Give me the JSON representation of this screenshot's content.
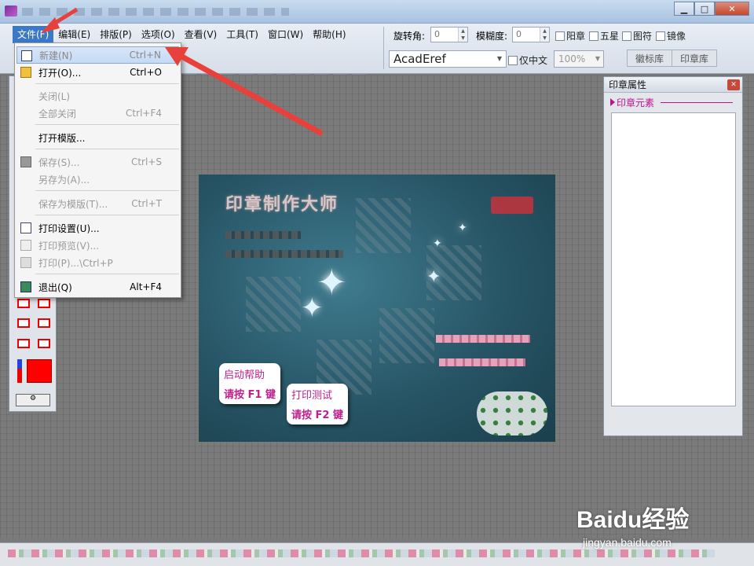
{
  "menubar": {
    "items": [
      "文件(F)",
      "编辑(E)",
      "排版(P)",
      "选项(O)",
      "查看(V)",
      "工具(T)",
      "窗口(W)",
      "帮助(H)"
    ]
  },
  "toolbar": {
    "rotate_label": "旋转角:",
    "rotate_value": "0",
    "blur_label": "模糊度:",
    "blur_value": "0",
    "checkboxes": [
      "阳章",
      "五星",
      "图符",
      "镜像"
    ],
    "font_value": "AcadEref",
    "chinese_only_label": "仅中文",
    "size_value": "100%",
    "tabs": [
      "徽标库",
      "印章库"
    ]
  },
  "file_menu": {
    "items": [
      {
        "label": "新建(N)",
        "shortcut": "Ctrl+N",
        "disabled": false,
        "highlighted": true
      },
      {
        "label": "打开(O)...",
        "shortcut": "Ctrl+O",
        "disabled": false
      },
      {
        "label": "关闭(L)",
        "shortcut": "",
        "disabled": true
      },
      {
        "label": "全部关闭",
        "shortcut": "Ctrl+F4",
        "disabled": true
      },
      {
        "label": "打开模版...",
        "shortcut": "",
        "disabled": false
      },
      {
        "label": "保存(S)...",
        "shortcut": "Ctrl+S",
        "disabled": true
      },
      {
        "label": "另存为(A)...",
        "shortcut": "",
        "disabled": true
      },
      {
        "label": "保存为模版(T)...",
        "shortcut": "Ctrl+T",
        "disabled": true
      },
      {
        "label": "打印设置(U)...",
        "shortcut": "",
        "disabled": false
      },
      {
        "label": "打印预览(V)...",
        "shortcut": "",
        "disabled": true
      },
      {
        "label": "打印(P)...\\Ctrl+P",
        "shortcut": "",
        "disabled": true
      },
      {
        "label": "退出(Q)",
        "shortcut": "Alt+F4",
        "disabled": false
      }
    ]
  },
  "splash": {
    "title": "印章制作大师",
    "help_card_1": {
      "line1": "启动帮助",
      "line2": "请按 F1 键"
    },
    "help_card_2": {
      "line1": "打印测试",
      "line2": "请按 F2 键"
    }
  },
  "properties_panel": {
    "title": "印章属性",
    "section": "印章元素"
  },
  "watermark": {
    "logo": "Baidu经验",
    "url": "jingyan.baidu.com"
  },
  "colors": {
    "accent": "#3c78c8",
    "annotation": "#e8403a",
    "section_magenta": "#c0108a"
  }
}
